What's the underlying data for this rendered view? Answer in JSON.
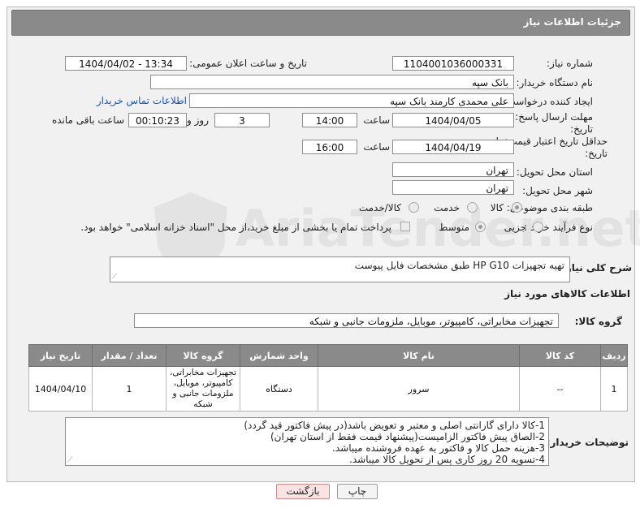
{
  "header": {
    "title": "جزئیات اطلاعات نیاز"
  },
  "form": {
    "need_number_label": "شماره نیاز:",
    "need_number": "1104001036000331",
    "announce_label": "تاریخ و ساعت اعلان عمومی:",
    "announce_value": "1404/04/02 - 13:34",
    "buyer_org_label": "نام دستگاه خریدار:",
    "buyer_org": "بانک سپه",
    "creator_label": "ایجاد کننده درخواست:",
    "creator": "علی محمدی کارمند بانک سپه",
    "contact_link": "اطلاعات تماس خریدار",
    "reply_deadline_label": "مهلت ارسال پاسخ: تا تاریخ:",
    "reply_date": "1404/04/05",
    "time_label": "ساعت",
    "reply_time": "14:00",
    "days_value": "3",
    "days_label": "روز و",
    "remaining_time": "00:10:23",
    "remaining_label": "ساعت باقی مانده",
    "validity_label": "حداقل تاریخ اعتبار قیمت: تا تاریخ:",
    "validity_date": "1404/04/19",
    "validity_time": "16:00",
    "province_label": "استان محل تحویل:",
    "province": "تهران",
    "city_label": "شهر محل تحویل:",
    "city": "تهران",
    "category_label": "طبقه بندی موضوعی:",
    "category_options": [
      "کالا",
      "خدمت",
      "کالا/خدمت"
    ],
    "process_label": "نوع فرآیند خرید :",
    "process_options": [
      "جزیی",
      "متوسط"
    ],
    "payment_note": "پرداخت تمام یا بخشی از مبلغ خرید،از محل \"اسناد خزانه اسلامی\" خواهد بود."
  },
  "summary": {
    "label": "شرح کلی نیاز:",
    "text": "تهیه تجهیزات HP G10 طبق مشخصات فایل پیوست"
  },
  "goods": {
    "section_title": "اطلاعات کالاهای مورد نیاز",
    "group_label": "گروه کالا:",
    "group_value": "تجهیزات مخابراتی، کامپیوتر، موبایل، ملزومات جانبی و شبکه",
    "columns": [
      "ردیف",
      "کد کالا",
      "نام کالا",
      "واحد شمارش",
      "گروه کالا",
      "تعداد / مقدار",
      "تاریخ نیاز"
    ],
    "rows": [
      {
        "index": "1",
        "code": "--",
        "name": "سرور",
        "unit": "دستگاه",
        "group": "تجهیزات مخابراتی، کامپیوتر، موبایل، ملزومات جانبی و شبکه",
        "qty": "1",
        "date": "1404/04/10"
      }
    ]
  },
  "buyer_notes": {
    "label": "توضیحات خریدار:",
    "lines": [
      "1-کالا دارای گارانتی اصلی و  معتبر و تعویض باشد(در پیش فاکتور قید گردد)",
      "2-الصاق پیش فاکتور الزامیست(پیشنهاد قیمت فقط از استان تهران)",
      "3-هزینه حمل کالا و فاکتور به عهده فروشنده میباشد.",
      "4-تسویه 20 روز کاری پس از تحویل کالا میباشد."
    ]
  },
  "buttons": {
    "print": "چاپ",
    "back": "بازگشت"
  },
  "watermark": {
    "text": "AriaTender.net"
  }
}
